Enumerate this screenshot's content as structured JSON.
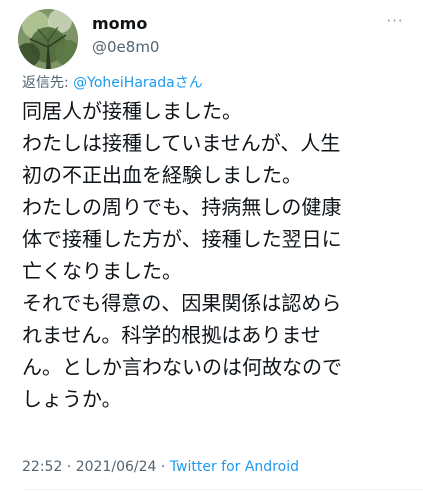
{
  "user": {
    "name": "momo",
    "handle": "@0e8m0",
    "avatar_icon": "forest-photo-avatar"
  },
  "more_icon": "more-dots-icon",
  "more_glyph": "···",
  "reply": {
    "prefix": "返信先: ",
    "mention": "@YoheiHaradaさん"
  },
  "body_lines": [
    "同居人が接種しました。",
    "わたしは接種していませんが、人生",
    "初の不正出血を経験しました。",
    "わたしの周りでも、持病無しの健康",
    "体で接種した方が、接種した翌日に",
    "亡くなりました。",
    "それでも得意の、因果関係は認めら",
    "れません。科学的根拠はありませ",
    "ん。としか言わないのは何故なので",
    "しょうか。"
  ],
  "meta": {
    "time": "22:52",
    "sep1": " · ",
    "date": "2021/06/24",
    "sep2": " · ",
    "source": "Twitter for Android"
  },
  "colors": {
    "accent": "#1d9bf0",
    "secondary_text": "#536471",
    "primary_text": "#0f1419"
  }
}
